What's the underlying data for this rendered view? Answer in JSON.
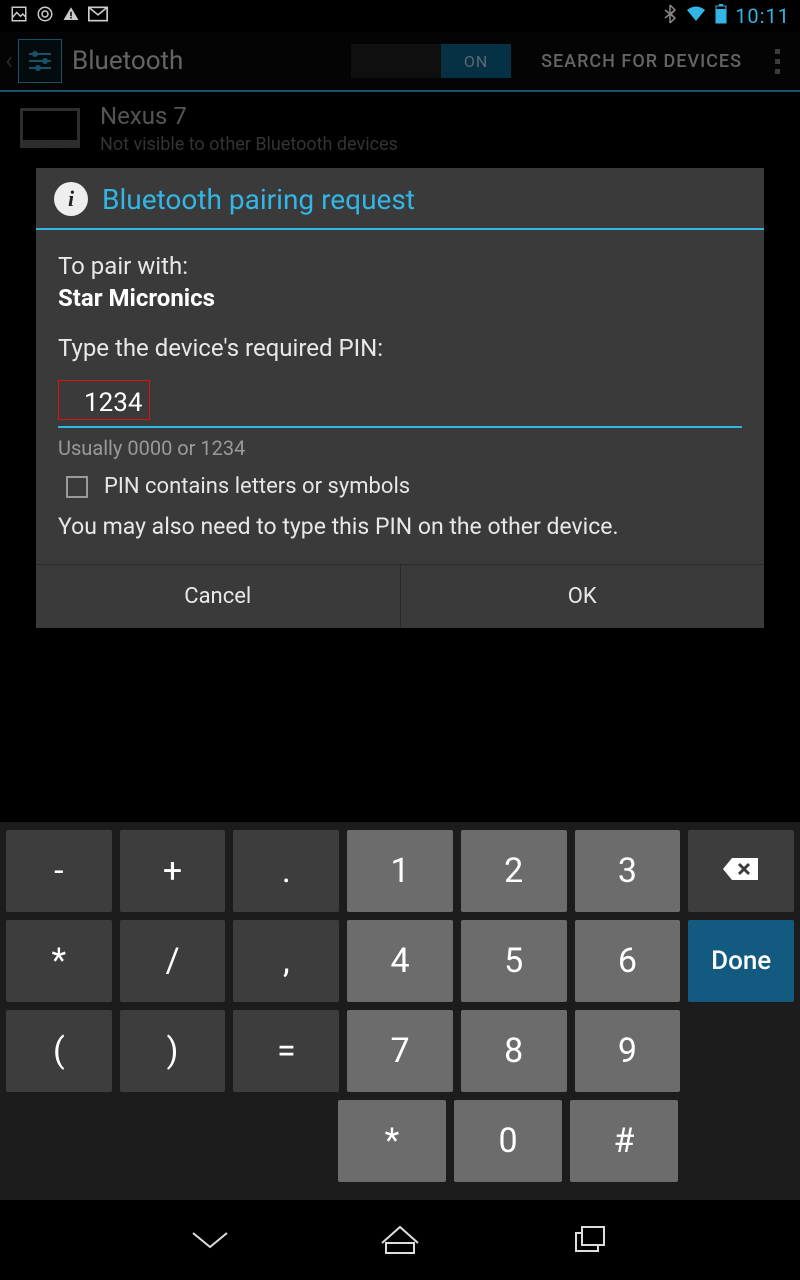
{
  "status": {
    "time": "10:11"
  },
  "actionbar": {
    "title": "Bluetooth",
    "toggle_on": "ON",
    "search": "SEARCH FOR DEVICES"
  },
  "bg": {
    "device": "Nexus 7",
    "sub": "Not visible to other Bluetooth devices"
  },
  "dialog": {
    "title": "Bluetooth pairing request",
    "pair_with_label": "To pair with:",
    "device_name": "Star Micronics",
    "prompt": "Type the device's required PIN:",
    "pin_value": "1234",
    "hint": "Usually 0000 or 1234",
    "checkbox_label": "PIN contains letters or symbols",
    "note": "You may also need to type this PIN on the other device.",
    "cancel": "Cancel",
    "ok": "OK"
  },
  "keys": {
    "row1": [
      "-",
      "+",
      ".",
      "1",
      "2",
      "3"
    ],
    "row2": [
      "*",
      "/",
      ",",
      "4",
      "5",
      "6"
    ],
    "row3": [
      "(",
      ")",
      "=",
      "7",
      "8",
      "9"
    ],
    "row4": [
      "*",
      "0",
      "#"
    ],
    "done": "Done"
  }
}
